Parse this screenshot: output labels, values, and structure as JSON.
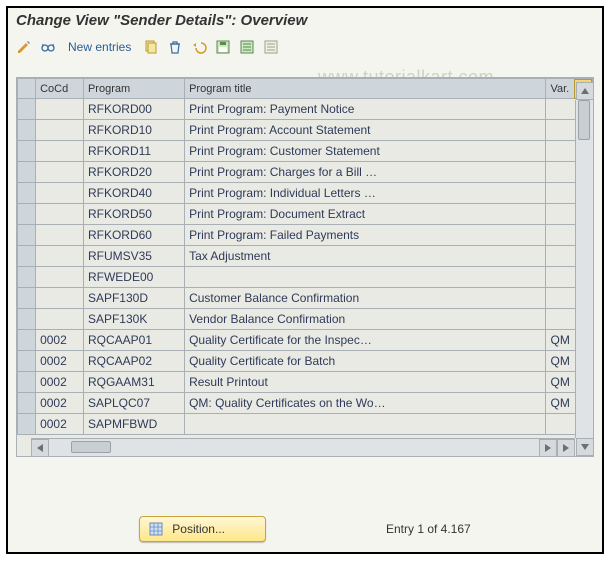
{
  "title": "Change View \"Sender Details\": Overview",
  "watermark": "www.tutorialkart.com",
  "toolbar": {
    "new_entries_label": "New entries"
  },
  "columns": {
    "cocd": "CoCd",
    "program": "Program",
    "program_title": "Program title",
    "var": "Var."
  },
  "rows": [
    {
      "cocd": "",
      "program": "RFKORD00",
      "title": "Print Program: Payment Notice",
      "var": ""
    },
    {
      "cocd": "",
      "program": "RFKORD10",
      "title": "Print Program: Account Statement",
      "var": ""
    },
    {
      "cocd": "",
      "program": "RFKORD11",
      "title": "Print Program: Customer Statement",
      "var": ""
    },
    {
      "cocd": "",
      "program": "RFKORD20",
      "title": "Print Program: Charges for a Bill …",
      "var": ""
    },
    {
      "cocd": "",
      "program": "RFKORD40",
      "title": "Print Program: Individual Letters …",
      "var": ""
    },
    {
      "cocd": "",
      "program": "RFKORD50",
      "title": "Print Program: Document Extract",
      "var": ""
    },
    {
      "cocd": "",
      "program": "RFKORD60",
      "title": "Print Program: Failed Payments",
      "var": ""
    },
    {
      "cocd": "",
      "program": "RFUMSV35",
      "title": "Tax Adjustment",
      "var": ""
    },
    {
      "cocd": "",
      "program": "RFWEDE00",
      "title": "",
      "var": ""
    },
    {
      "cocd": "",
      "program": "SAPF130D",
      "title": "Customer Balance Confirmation",
      "var": ""
    },
    {
      "cocd": "",
      "program": "SAPF130K",
      "title": "Vendor Balance Confirmation",
      "var": ""
    },
    {
      "cocd": "0002",
      "program": "RQCAAP01",
      "title": "Quality Certificate for the Inspec…",
      "var": "QM"
    },
    {
      "cocd": "0002",
      "program": "RQCAAP02",
      "title": "Quality Certificate for Batch",
      "var": "QM"
    },
    {
      "cocd": "0002",
      "program": "RQGAAM31",
      "title": "Result Printout",
      "var": "QM"
    },
    {
      "cocd": "0002",
      "program": "SAPLQC07",
      "title": "QM: Quality Certificates on the Wo…",
      "var": "QM"
    },
    {
      "cocd": "0002",
      "program": "SAPMFBWD",
      "title": "",
      "var": ""
    }
  ],
  "footer": {
    "position_label": "Position...",
    "entry_text": "Entry 1 of 4.167"
  }
}
